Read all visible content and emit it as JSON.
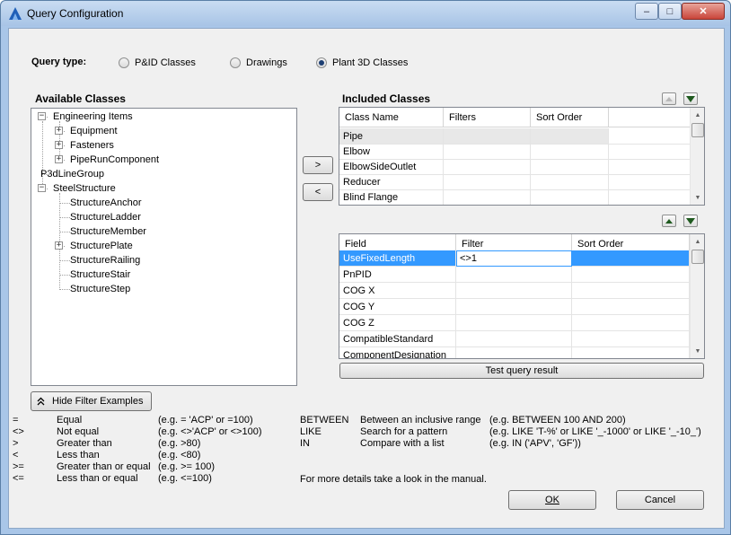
{
  "window": {
    "title": "Query Configuration",
    "minimize": "–",
    "maximize": "□",
    "close": "✕"
  },
  "query_type": {
    "label": "Query type:",
    "options": [
      {
        "label": "P&ID Classes",
        "selected": false
      },
      {
        "label": "Drawings",
        "selected": false
      },
      {
        "label": "Plant 3D Classes",
        "selected": true
      }
    ]
  },
  "available": {
    "label": "Available Classes",
    "nodes": [
      "Engineering Items",
      "Equipment",
      "Fasteners",
      "PipeRunComponent",
      "P3dLineGroup",
      "SteelStructure",
      "StructureAnchor",
      "StructureLadder",
      "StructureMember",
      "StructurePlate",
      "StructureRailing",
      "StructureStair",
      "StructureStep"
    ]
  },
  "move": {
    "add": ">",
    "remove": "<"
  },
  "included": {
    "label": "Included Classes",
    "columns": [
      "Class Name",
      "Filters",
      "Sort Order"
    ],
    "rows": [
      "Pipe",
      "Elbow",
      "ElbowSideOutlet",
      "Reducer",
      "Blind Flange"
    ]
  },
  "fields": {
    "columns": [
      "Field",
      "Filter",
      "Sort Order"
    ],
    "rows": [
      {
        "field": "UseFixedLength",
        "filter": "<>1",
        "sort": ""
      },
      {
        "field": "PnPID",
        "filter": "",
        "sort": ""
      },
      {
        "field": "COG X",
        "filter": "",
        "sort": ""
      },
      {
        "field": "COG Y",
        "filter": "",
        "sort": ""
      },
      {
        "field": "COG Z",
        "filter": "",
        "sort": ""
      },
      {
        "field": "CompatibleStandard",
        "filter": "",
        "sort": ""
      },
      {
        "field": "ComponentDesignation",
        "filter": "",
        "sort": ""
      }
    ]
  },
  "test_button": "Test query result",
  "hide_filter_button": "Hide Filter Examples",
  "examples_left": [
    {
      "op": "=",
      "desc": "Equal",
      "eg": "(e.g. = 'ACP' or =100)"
    },
    {
      "op": "<>",
      "desc": "Not equal",
      "eg": "(e.g. <>'ACP' or <>100)"
    },
    {
      "op": ">",
      "desc": "Greater than",
      "eg": "(e.g. >80)"
    },
    {
      "op": "<",
      "desc": "Less than",
      "eg": "(e.g. <80)"
    },
    {
      "op": ">=",
      "desc": "Greater than or equal",
      "eg": "(e.g. >= 100)"
    },
    {
      "op": "<=",
      "desc": "Less than or equal",
      "eg": "(e.g. <=100)"
    }
  ],
  "examples_right": [
    {
      "op": "BETWEEN",
      "desc": "Between an inclusive range",
      "eg": "(e.g. BETWEEN 100 AND 200)"
    },
    {
      "op": "LIKE",
      "desc": "Search for a pattern",
      "eg": "(e.g. LIKE 'T-%' or LIKE '_-1000' or LIKE '_-10_')"
    },
    {
      "op": "IN",
      "desc": "Compare with a list",
      "eg": "(e.g. IN ('APV', 'GF'))"
    }
  ],
  "manual_note": "For more details take a look in the manual.",
  "ok": "OK",
  "cancel": "Cancel"
}
